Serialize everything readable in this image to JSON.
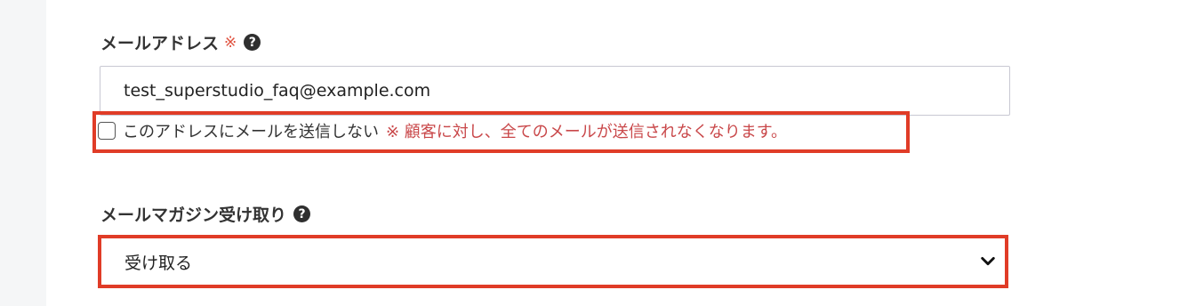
{
  "email_field": {
    "label": "メールアドレス",
    "required_mark": "※",
    "help_icon": "question-circle-icon",
    "value": "test_superstudio_faq@example.com",
    "no_mail_checkbox": {
      "checked": false,
      "label": "このアドレスにメールを送信しない",
      "warning": "※ 顧客に対し、全てのメールが送信されなくなります。"
    }
  },
  "newsletter_field": {
    "label": "メールマガジン受け取り",
    "help_icon": "question-circle-icon",
    "selected_value": "受け取る",
    "dropdown_icon": "chevron-down-icon"
  },
  "colors": {
    "highlight_border": "#e03c27",
    "required_mark": "#e0523f",
    "warning_text": "#c9484a",
    "gutter_bg": "#f5f6f7"
  }
}
